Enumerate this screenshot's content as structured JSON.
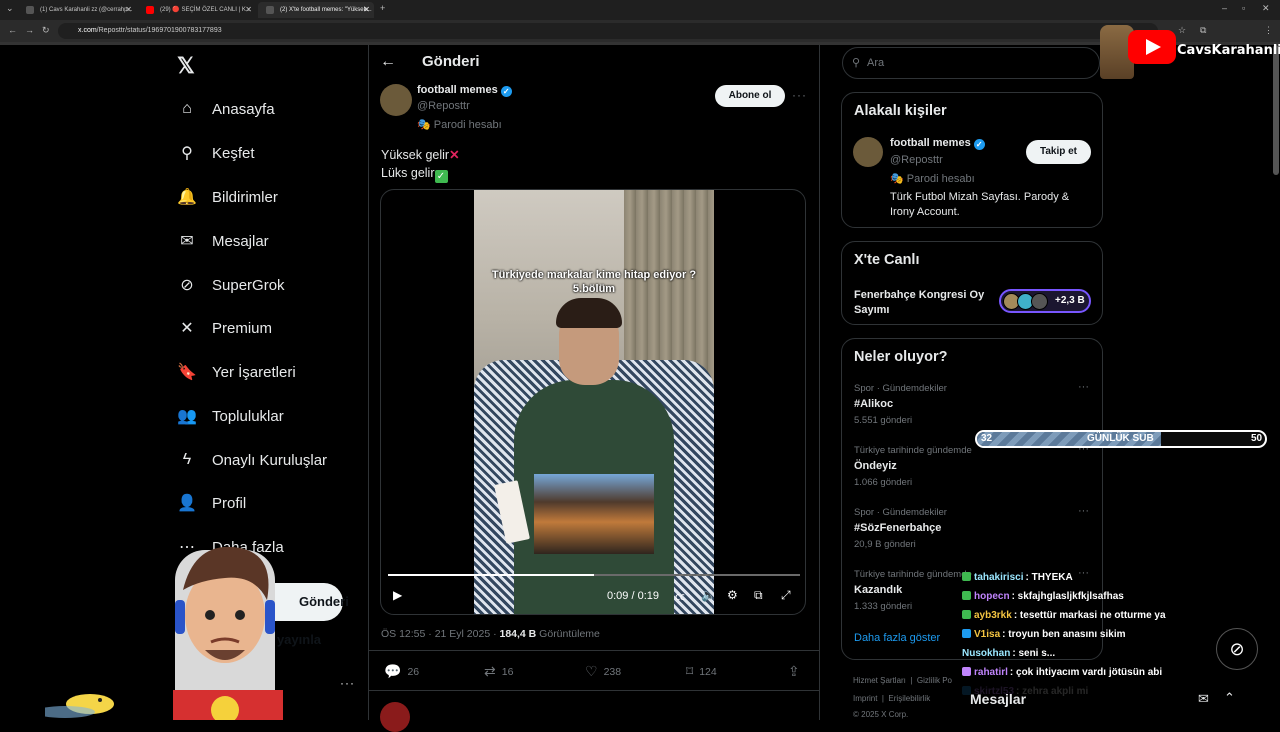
{
  "browser": {
    "tabs": [
      {
        "label": "(1) Cavs Karahanli zz (@cerrahp...",
        "color": "#9aa0a6"
      },
      {
        "label": "(29) 🔴 SEÇİM ÖZEL CANLI | K...",
        "color": "#ff0000"
      },
      {
        "label": "(2) X'te football memes: \"Yüksek...",
        "color": "#9aa0a6"
      }
    ],
    "url_domain": "x.com",
    "url_path": "/Reposttr/status/1969701900783177893"
  },
  "nav": {
    "items": [
      {
        "label": "Anasayfa",
        "icon": "home-icon",
        "glyph": "⌂"
      },
      {
        "label": "Keşfet",
        "icon": "search-icon",
        "glyph": "⚲"
      },
      {
        "label": "Bildirimler",
        "icon": "bell-icon",
        "glyph": "🔔",
        "badge": "2"
      },
      {
        "label": "Mesajlar",
        "icon": "envelope-icon",
        "glyph": "✉"
      },
      {
        "label": "SuperGrok",
        "icon": "grok-icon",
        "glyph": "⊘"
      },
      {
        "label": "Premium",
        "icon": "x-premium-icon",
        "glyph": "✕"
      },
      {
        "label": "Yer İşaretleri",
        "icon": "bookmark-icon",
        "glyph": "🔖"
      },
      {
        "label": "Topluluklar",
        "icon": "communities-icon",
        "glyph": "👥"
      },
      {
        "label": "Onaylı Kuruluşlar",
        "icon": "lightning-icon",
        "glyph": "ϟ"
      },
      {
        "label": "Profil",
        "icon": "profile-icon",
        "glyph": "👤"
      },
      {
        "label": "Daha fazla",
        "icon": "more-circle-icon",
        "glyph": "⋯"
      }
    ],
    "post_button": "Gönderi yayınla"
  },
  "post": {
    "heading": "Gönderi",
    "author": "football memes",
    "handle": "@Reposttr",
    "parody_label": "Parodi hesabı",
    "subscribe": "Abone ol",
    "line1": "Yüksek gelir",
    "line2": "Lüks gelir",
    "video_caption": "Türkiyede markalar kime hitap ediyor ? 5.bölüm",
    "video_progress": 0.5,
    "video_time": "0:09 / 0:19",
    "timestamp": "ÖS 12:55 · 21 Eyl 2025 · ",
    "views": "184,4 B",
    "views_label": " Görüntüleme",
    "replies": "26",
    "reposts": "16",
    "likes": "238",
    "bookmarks": "124"
  },
  "sidebar": {
    "search_placeholder": "Ara",
    "relevant_title": "Alakalı kişiler",
    "relevant": {
      "name": "football memes",
      "handle": "@Reposttr",
      "parody": "Parodi hesabı",
      "bio": "Türk Futbol Mizah Sayfası. Parody & Irony Account.",
      "follow": "Takip et"
    },
    "live_title": "X'te Canlı",
    "live": {
      "title": "Fenerbahçe Kongresi Oy Sayımı",
      "count": "+2,3 B"
    },
    "trending_title": "Neler oluyor?",
    "trends": [
      {
        "context": "Spor · Gündemdekiler",
        "name": "#Alikoc",
        "count": "5.551 gönderi"
      },
      {
        "context": "Türkiye tarihinde gündemde",
        "name": "Öndeyiz",
        "count": "1.066 gönderi"
      },
      {
        "context": "Spor · Gündemdekiler",
        "name": "#SözFenerbahçe",
        "count": "20,9 B gönderi"
      },
      {
        "context": "Türkiye tarihinde gündemde",
        "name": "Kazandık",
        "count": "1.333 gönderi"
      }
    ],
    "show_more": "Daha fazla göster",
    "footer": [
      "Hizmet Şartları",
      "Gizlilik Po",
      "Imprint",
      "Erişilebilirlik",
      "© 2025 X Corp."
    ]
  },
  "overlay": {
    "channel": "CavsKarahanli",
    "sub_goal": {
      "current": "32",
      "label": "GÜNLÜK SUB",
      "target": "50",
      "fraction": 0.64
    },
    "chat": [
      {
        "user": "tahakirisci",
        "msg": ": THYEKA",
        "color": "#9be7ff"
      },
      {
        "user": "hopecn",
        "msg": ": skfajhglasljkfkjlsafhas",
        "color": "#c084fc"
      },
      {
        "user": "ayb3rkk",
        "msg": ": tesettür markasi ne otturme ya",
        "color": "#f5c542"
      },
      {
        "user": "V1isa",
        "msg": ": troyun ben anasını sikim",
        "color": "#f5c542"
      },
      {
        "user": "Nusokhan",
        "msg": ": seni s...",
        "color": "#9be7ff"
      },
      {
        "user": "rahatirl",
        "msg": ": çok ihtiyacım vardı jötüsün abi",
        "color": "#c084fc"
      },
      {
        "user": "skirtzl53",
        "msg": ": zehra akpli mi",
        "color": "#c084fc"
      }
    ],
    "messages_label": "Mesajlar"
  },
  "colors": {
    "accent": "#1d9bf0",
    "bg": "#000000",
    "muted": "#71767b",
    "border": "#2f3336"
  }
}
